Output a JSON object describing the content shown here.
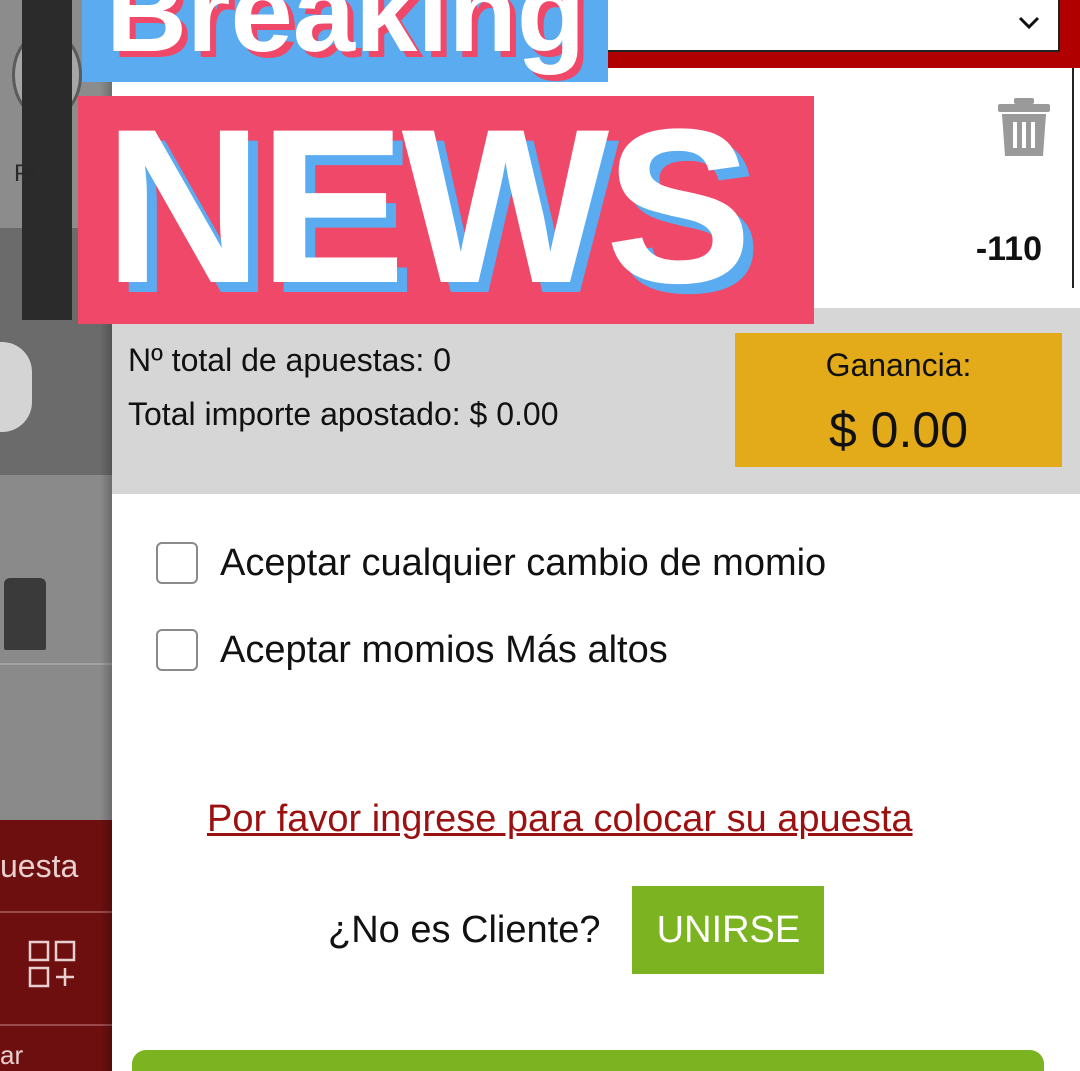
{
  "background_app": {
    "label_fragment": "Pt",
    "red_tab_fragment": "uesta",
    "bottom_fragment": "ar"
  },
  "overlay": {
    "line1": "Breaking",
    "line2": "NEWS"
  },
  "bet": {
    "odds": "-110"
  },
  "summary": {
    "total_bets": "Nº total de apuestas: 0",
    "total_amount": "Total importe apostado: $ 0.00",
    "gain_label": "Ganancia:",
    "gain_value": "$ 0.00"
  },
  "options": [
    {
      "label": "Aceptar cualquier cambio de momio",
      "checked": false
    },
    {
      "label": "Aceptar momios Más altos",
      "checked": false
    }
  ],
  "login_prompt": "Por favor ingrese para colocar su apuesta",
  "join": {
    "question": "¿No es Cliente?",
    "button": "UNIRSE"
  },
  "colors": {
    "brand_red": "#b00000",
    "gain_yellow": "#e3ab19",
    "join_green": "#7cb421",
    "link_red": "#9b1111",
    "overlay_pink": "#ef4868",
    "overlay_blue": "#5aabf0"
  }
}
